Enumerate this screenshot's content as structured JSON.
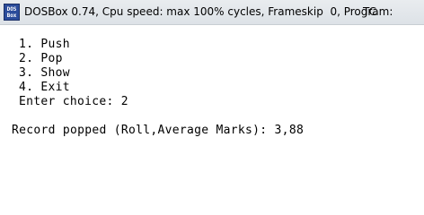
{
  "window": {
    "title": "DOSBox 0.74, Cpu speed: max 100% cycles, Frameskip  0, Program:",
    "program": "TC",
    "icon": "dosbox-icon",
    "icon_text_top": "DOS",
    "icon_text_bottom": "Box"
  },
  "console": {
    "menu": [
      "1. Push",
      "2. Pop",
      "3. Show",
      "4. Exit"
    ],
    "prompt": "Enter choice: 2",
    "output": "Record popped (Roll,Average Marks): 3,88"
  }
}
